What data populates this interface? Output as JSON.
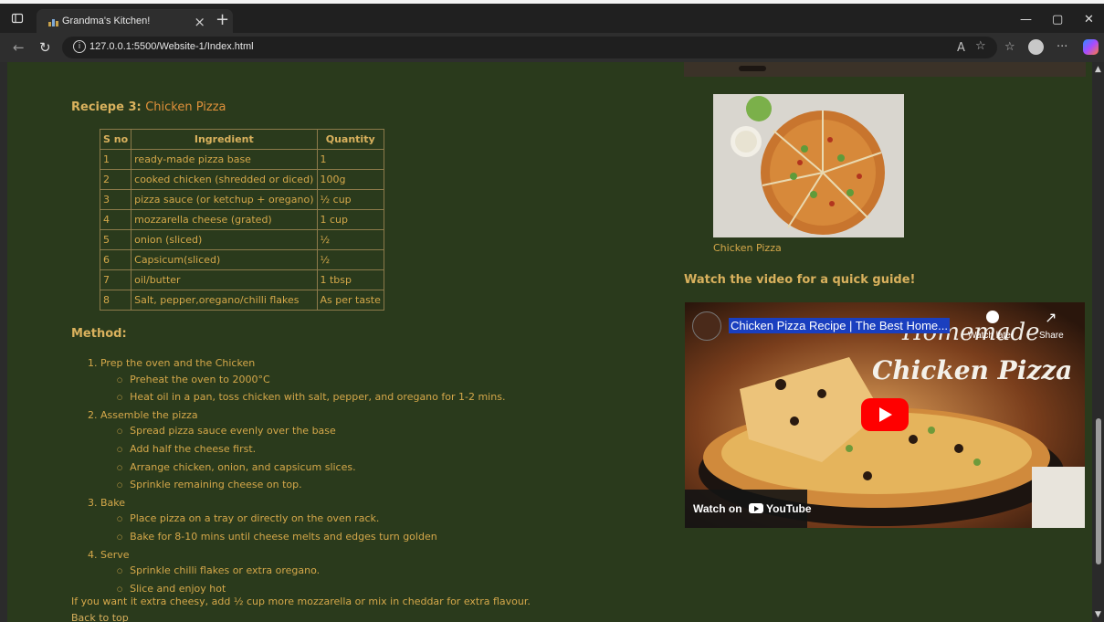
{
  "browser": {
    "tab_title": "Grandma's Kitchen!",
    "url": "127.0.0.1:5500/Website-1/Index.html",
    "new_tab": "+",
    "tab_close": "×"
  },
  "recipe": {
    "label": "Reciepe 3:",
    "name": "Chicken Pizza",
    "table": {
      "headers": [
        "S no",
        "Ingredient",
        "Quantity"
      ],
      "rows": [
        [
          "1",
          "ready-made pizza base",
          "1"
        ],
        [
          "2",
          "cooked chicken (shredded or diced)",
          "100g"
        ],
        [
          "3",
          "pizza sauce (or ketchup + oregano)",
          "½ cup"
        ],
        [
          "4",
          "mozzarella cheese (grated)",
          "1 cup"
        ],
        [
          "5",
          "onion (sliced)",
          "½"
        ],
        [
          "6",
          "Capsicum(sliced)",
          "½"
        ],
        [
          "7",
          "oil/butter",
          "1 tbsp"
        ],
        [
          "8",
          "Salt, pepper,oregano/chilli flakes",
          "As per taste"
        ]
      ]
    },
    "method_heading": "Method:",
    "steps": [
      {
        "title": "1. Prep the oven and the Chicken",
        "subs": [
          "Preheat the oven to 2000°C",
          "Heat oil in a pan, toss chicken with salt, pepper, and oregano for 1-2 mins."
        ]
      },
      {
        "title": "2. Assemble the pizza",
        "subs": [
          "Spread pizza sauce evenly over the base",
          "Add half the cheese first.",
          "Arrange chicken, onion, and capsicum slices.",
          "Sprinkle remaining cheese on top."
        ]
      },
      {
        "title": "3. Bake",
        "subs": [
          "Place pizza on a tray or directly on the oven rack.",
          "Bake for 8-10 mins until cheese melts and edges turn golden"
        ]
      },
      {
        "title": "4. Serve",
        "subs": [
          "Sprinkle chilli flakes or extra oregano.",
          "Slice and enjoy hot"
        ]
      }
    ],
    "tip": "If you want it extra cheesy, add ½ cup more mozzarella or mix in cheddar for extra flavour.",
    "back_to_top": "Back to top",
    "image_caption": "Chicken Pizza",
    "video_heading": "Watch the video for a quick guide!",
    "video": {
      "title": "Chicken Pizza Recipe | The Best Home...",
      "watch_later": "Watch later",
      "share": "Share",
      "brand_line1": "Homemade",
      "brand_line2": "Chicken Pizza",
      "watch_on": "Watch on",
      "youtube": "YouTube"
    }
  },
  "colors": {
    "page_bg": "#2a3a1c",
    "text": "#d5a84a",
    "accent": "#e0913a",
    "yt_red": "#ff0000"
  }
}
